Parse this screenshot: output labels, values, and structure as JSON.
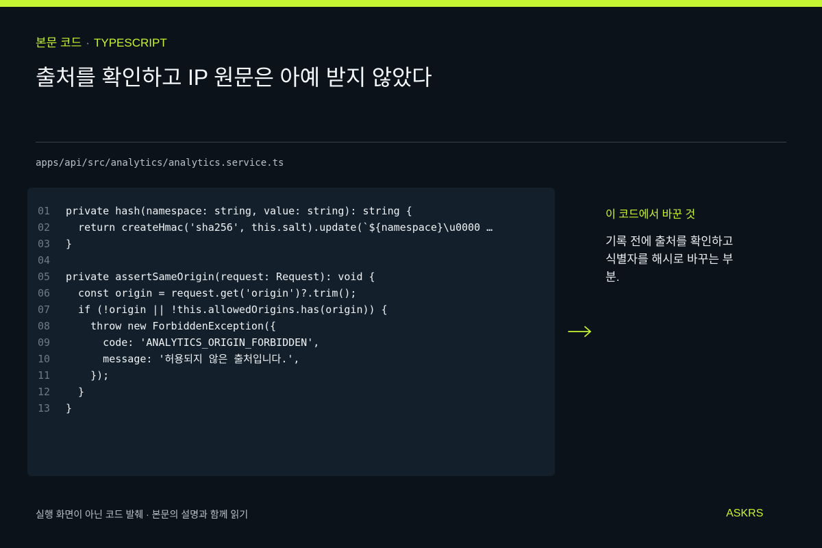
{
  "header": {
    "category": "본문 코드",
    "separator": "·",
    "language": "TYPESCRIPT",
    "title": "출처를 확인하고 IP 원문은 아예 받지 않았다"
  },
  "file": {
    "path": "apps/api/src/analytics/analytics.service.ts"
  },
  "code": {
    "lines": [
      {
        "no": "01",
        "text": "private hash(namespace: string, value: string): string {"
      },
      {
        "no": "02",
        "text": "  return createHmac('sha256', this.salt).update(`${namespace}\\u0000 …"
      },
      {
        "no": "03",
        "text": "}"
      },
      {
        "no": "04",
        "text": ""
      },
      {
        "no": "05",
        "text": "private assertSameOrigin(request: Request): void {"
      },
      {
        "no": "06",
        "text": "  const origin = request.get('origin')?.trim();"
      },
      {
        "no": "07",
        "text": "  if (!origin || !this.allowedOrigins.has(origin)) {"
      },
      {
        "no": "08",
        "text": "    throw new ForbiddenException({"
      },
      {
        "no": "09",
        "text": "      code: 'ANALYTICS_ORIGIN_FORBIDDEN',"
      },
      {
        "no": "10",
        "text": "      message: '허용되지 않은 출처입니다.',"
      },
      {
        "no": "11",
        "text": "    });"
      },
      {
        "no": "12",
        "text": "  }"
      },
      {
        "no": "13",
        "text": "}"
      }
    ]
  },
  "aside": {
    "arrow_icon": "arrow-right-icon",
    "label": "이 코드에서 바꾼 것",
    "description": "기록 전에 출처를 확인하고 식별자를 해시로 바꾸는 부분."
  },
  "footer": {
    "note": "실행 화면이 아닌 코드 발췌 · 본문의 설명과 함께 읽기",
    "brand": "ASKRS"
  },
  "colors": {
    "background": "#0b1219",
    "accent": "#c6f432",
    "code_panel": "#131f2b",
    "line_number": "#6e7b87"
  }
}
